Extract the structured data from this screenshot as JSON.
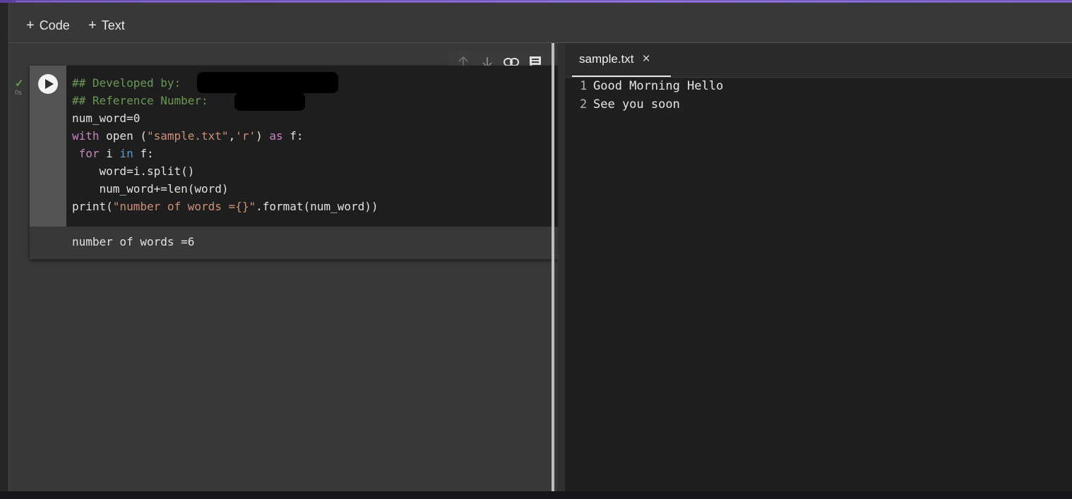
{
  "toolbar": {
    "code_label": "Code",
    "text_label": "Text",
    "plus_symbol": "+"
  },
  "cell": {
    "status_check": "✓",
    "status_time": "0s",
    "code_lines": [
      [
        {
          "t": "## Developed by:",
          "c": "cm"
        }
      ],
      [
        {
          "t": "## Reference Number:",
          "c": "cm"
        }
      ],
      [
        {
          "t": "num_word=0",
          "c": ""
        }
      ],
      [
        {
          "t": "with",
          "c": "kw"
        },
        {
          "t": " open (",
          "c": ""
        },
        {
          "t": "\"sample.txt\"",
          "c": "str"
        },
        {
          "t": ",",
          "c": ""
        },
        {
          "t": "'r'",
          "c": "str"
        },
        {
          "t": ") ",
          "c": ""
        },
        {
          "t": "as",
          "c": "kw"
        },
        {
          "t": " f:",
          "c": ""
        }
      ],
      [
        {
          "t": " ",
          "c": ""
        },
        {
          "t": "for",
          "c": "kw"
        },
        {
          "t": " i ",
          "c": ""
        },
        {
          "t": "in",
          "c": "kwb"
        },
        {
          "t": " f:",
          "c": ""
        }
      ],
      [
        {
          "t": "    word=i.split()",
          "c": ""
        }
      ],
      [
        {
          "t": "    num_word+=len(word)",
          "c": ""
        }
      ],
      [
        {
          "t": "print(",
          "c": ""
        },
        {
          "t": "\"number of words ={}\"",
          "c": "str"
        },
        {
          "t": ".format(num_word))",
          "c": ""
        }
      ]
    ],
    "output": "number of words =6"
  },
  "file_panel": {
    "tab_label": "sample.txt",
    "close_symbol": "×",
    "lines": [
      {
        "num": "1",
        "text": "Good Morning Hello"
      },
      {
        "num": "2",
        "text": "See you soon"
      }
    ]
  },
  "colors": {
    "accent": "#7a59c8",
    "comment": "#6a9955",
    "keyword": "#c586c0",
    "string": "#ce9178",
    "run_check": "#5aa34a"
  },
  "icons": {
    "cell_actions": [
      "arrow-up-icon",
      "arrow-down-icon",
      "link-icon",
      "comment-icon"
    ],
    "run": "play-icon",
    "close": "close-icon"
  }
}
